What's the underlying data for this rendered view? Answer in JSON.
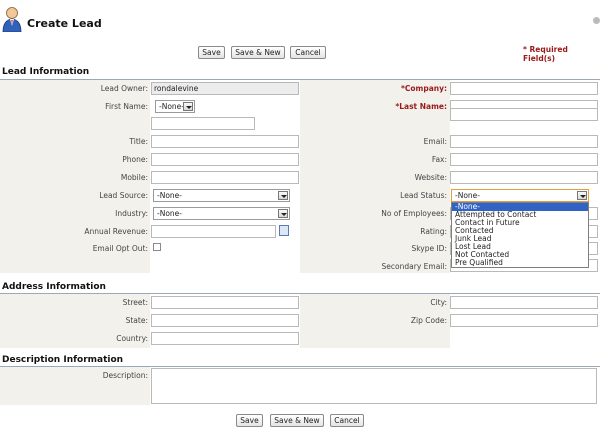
{
  "header": {
    "title": "Create Lead",
    "required_note": "* Required Field(s)"
  },
  "buttons": {
    "save": "Save",
    "save_new": "Save & New",
    "cancel": "Cancel"
  },
  "sections": {
    "lead_info": "Lead Information",
    "address_info": "Address Information",
    "description_info": "Description Information"
  },
  "lead": {
    "lead_owner_label": "Lead Owner:",
    "lead_owner_value": "rondalevine",
    "company_label": "*Company:",
    "first_name_label": "First Name:",
    "salutation_value": "-None-",
    "last_name_label": "*Last Name:",
    "title_label": "Title:",
    "email_label": "Email:",
    "phone_label": "Phone:",
    "fax_label": "Fax:",
    "mobile_label": "Mobile:",
    "website_label": "Website:",
    "lead_source_label": "Lead Source:",
    "lead_source_value": "-None-",
    "lead_status_label": "Lead Status:",
    "lead_status_value": "-None-",
    "industry_label": "Industry:",
    "industry_value": "-None-",
    "employees_label": "No of Employees:",
    "annual_revenue_label": "Annual Revenue:",
    "rating_label": "Rating:",
    "email_opt_out_label": "Email Opt Out:",
    "skype_label": "Skype ID:",
    "secondary_email_label": "Secondary Email:"
  },
  "lead_status_options": [
    "-None-",
    "Attempted to Contact",
    "Contact in Future",
    "Contacted",
    "Junk Lead",
    "Lost Lead",
    "Not Contacted",
    "Pre Qualified"
  ],
  "address": {
    "street_label": "Street:",
    "city_label": "City:",
    "state_label": "State:",
    "zip_label": "Zip Code:",
    "country_label": "Country:"
  },
  "description": {
    "description_label": "Description:"
  },
  "colors": {
    "required": "#9a1a1a",
    "highlight": "#3163c4",
    "band": "#f3f1ec"
  }
}
